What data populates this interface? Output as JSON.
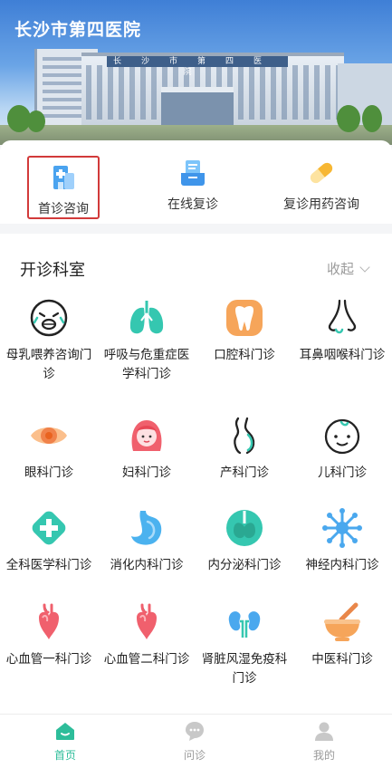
{
  "header": {
    "title": "长沙市第四医院",
    "building_sign": "长沙市第四医院"
  },
  "actions": [
    {
      "label": "首诊咨询",
      "icon": "hospital-building-icon",
      "selected": true
    },
    {
      "label": "在线复诊",
      "icon": "online-revisit-icon",
      "selected": false
    },
    {
      "label": "复诊用药咨询",
      "icon": "pill-capsule-icon",
      "selected": false
    }
  ],
  "departments": {
    "title": "开诊科室",
    "collapse_label": "收起",
    "items": [
      {
        "label": "母乳喂养咨询门诊",
        "icon": "crying-baby-icon"
      },
      {
        "label": "呼吸与危重症医学科门诊",
        "icon": "lungs-icon"
      },
      {
        "label": "口腔科门诊",
        "icon": "tooth-icon"
      },
      {
        "label": "耳鼻咽喉科门诊",
        "icon": "nose-icon"
      },
      {
        "label": "眼科门诊",
        "icon": "eye-icon"
      },
      {
        "label": "妇科门诊",
        "icon": "woman-face-icon"
      },
      {
        "label": "产科门诊",
        "icon": "pregnant-belly-icon"
      },
      {
        "label": "儿科门诊",
        "icon": "child-face-icon"
      },
      {
        "label": "全科医学科门诊",
        "icon": "medical-cross-icon"
      },
      {
        "label": "消化内科门诊",
        "icon": "stomach-icon"
      },
      {
        "label": "内分泌科门诊",
        "icon": "thyroid-icon"
      },
      {
        "label": "神经内科门诊",
        "icon": "neuron-icon"
      },
      {
        "label": "心血管一科门诊",
        "icon": "heart-icon"
      },
      {
        "label": "心血管二科门诊",
        "icon": "heart-icon"
      },
      {
        "label": "肾脏风湿免疫科门诊",
        "icon": "kidneys-icon"
      },
      {
        "label": "中医科门诊",
        "icon": "mortar-pestle-icon"
      }
    ]
  },
  "tabbar": [
    {
      "label": "首页",
      "icon": "home-icon",
      "active": true
    },
    {
      "label": "问诊",
      "icon": "chat-bubble-icon",
      "active": false
    },
    {
      "label": "我的",
      "icon": "user-icon",
      "active": false
    }
  ],
  "colors": {
    "accent": "#2dbd9a",
    "selection_border": "#d23a3a",
    "icon_pink": "#f0606d",
    "icon_teal": "#35c7b0",
    "icon_orange": "#f6a55a"
  }
}
